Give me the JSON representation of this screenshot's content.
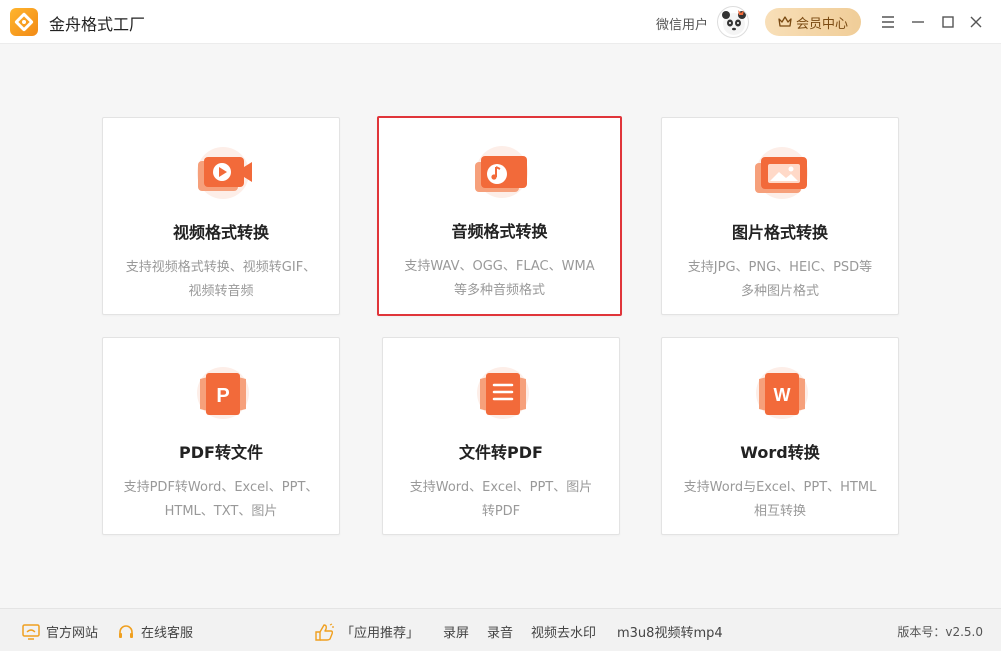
{
  "app": {
    "title": "金舟格式工厂"
  },
  "user": {
    "name": "微信用户"
  },
  "header": {
    "vip_label": "会员中心"
  },
  "window_controls": [
    "menu-icon",
    "minimize-icon",
    "maximize-icon",
    "close-icon"
  ],
  "cards": [
    {
      "title": "视频格式转换",
      "desc_line1": "支持视频格式转换、视频转GIF、",
      "desc_line2": "视频转音频",
      "icon": "video-icon"
    },
    {
      "title": "音频格式转换",
      "desc_line1": "支持WAV、OGG、FLAC、WMA",
      "desc_line2": "等多种音频格式",
      "icon": "music-icon",
      "selected": true
    },
    {
      "title": "图片格式转换",
      "desc_line1": "支持JPG、PNG、HEIC、PSD等",
      "desc_line2": "多种图片格式",
      "icon": "image-icon"
    },
    {
      "title": "PDF转文件",
      "desc_line1": "支持PDF转Word、Excel、PPT、",
      "desc_line2": "HTML、TXT、图片",
      "icon": "pdf-icon"
    },
    {
      "title": "文件转PDF",
      "desc_line1": "支持Word、Excel、PPT、图片",
      "desc_line2": "转PDF",
      "icon": "document-icon"
    },
    {
      "title": "Word转换",
      "desc_line1": "支持Word与Excel、PPT、HTML",
      "desc_line2": "相互转换",
      "icon": "word-icon"
    }
  ],
  "footer": {
    "website": "官方网站",
    "support": "在线客服",
    "recommend": "「应用推荐」",
    "links": [
      "录屏",
      "录音",
      "视频去水印",
      "m3u8视频转mp4"
    ],
    "version": "版本号：v2.5.0"
  },
  "colors": {
    "accent": "#f26a3a",
    "selected_border": "#e0353a",
    "vip_gold": "#f0cd98"
  }
}
